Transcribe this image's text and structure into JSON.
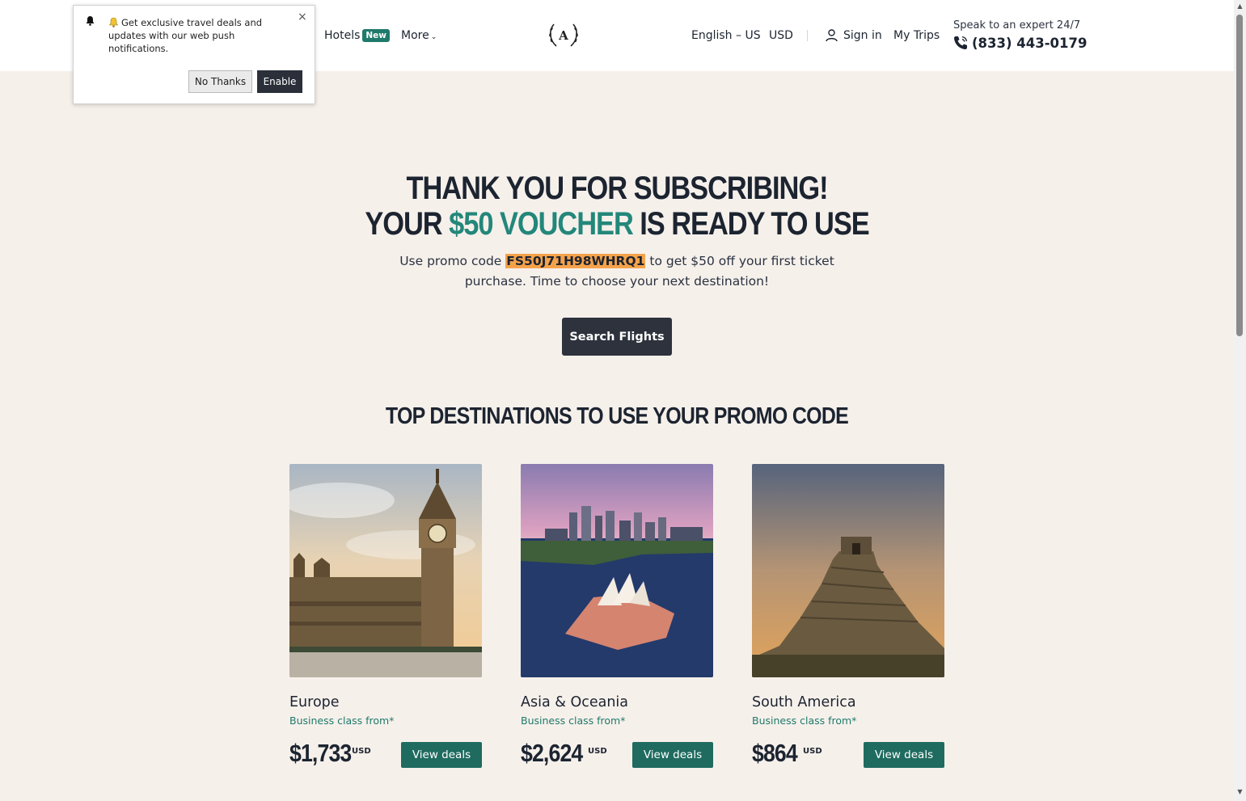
{
  "header": {
    "hotels_label": "Hotels",
    "hotels_badge": "New",
    "more_label": "More",
    "logo_letter": "A",
    "language": "English – US",
    "currency": "USD",
    "signin_label": "Sign in",
    "my_trips_label": "My Trips",
    "expert_label": "Speak to an expert 24/7",
    "phone": "(833) 443-0179"
  },
  "push_prompt": {
    "message": "Get exclusive travel deals and updates with our web push notifications.",
    "close_symbol": "×",
    "no_thanks_label": "No Thanks",
    "enable_label": "Enable"
  },
  "hero": {
    "line1": "THANK YOU FOR SUBSCRIBING!",
    "line2_before": "YOUR",
    "line2_accent": "$50 VOUCHER",
    "line2_after": "IS READY TO USE",
    "promo_before": "Use promo code",
    "promo_code": "FS50J71H98WHRQ1",
    "promo_after": "to get $50 off your first ticket purchase. Time to choose your next destination!",
    "search_button": "Search Flights"
  },
  "destinations": {
    "title": "TOP DESTINATIONS TO USE YOUR PROMO CODE",
    "cards": [
      {
        "name": "Europe",
        "subtitle": "Business class from*",
        "price": "$1,733",
        "currency": "USD",
        "button": "View deals"
      },
      {
        "name": "Asia & Oceania",
        "subtitle": "Business class from*",
        "price": "$2,624",
        "currency": "USD",
        "button": "View deals"
      },
      {
        "name": "South America",
        "subtitle": "Business class from*",
        "price": "$864",
        "currency": "USD",
        "button": "View deals"
      }
    ]
  },
  "colors": {
    "accent_green": "#23877a",
    "button_green": "#1f6b5f",
    "promo_highlight": "#f5a24b",
    "page_background": "#f6f0eb",
    "dark_button": "#2e323d"
  },
  "icons": [
    "bell-icon",
    "close-icon",
    "chevron-down-icon",
    "laurel-logo-icon",
    "user-icon",
    "phone-icon"
  ]
}
